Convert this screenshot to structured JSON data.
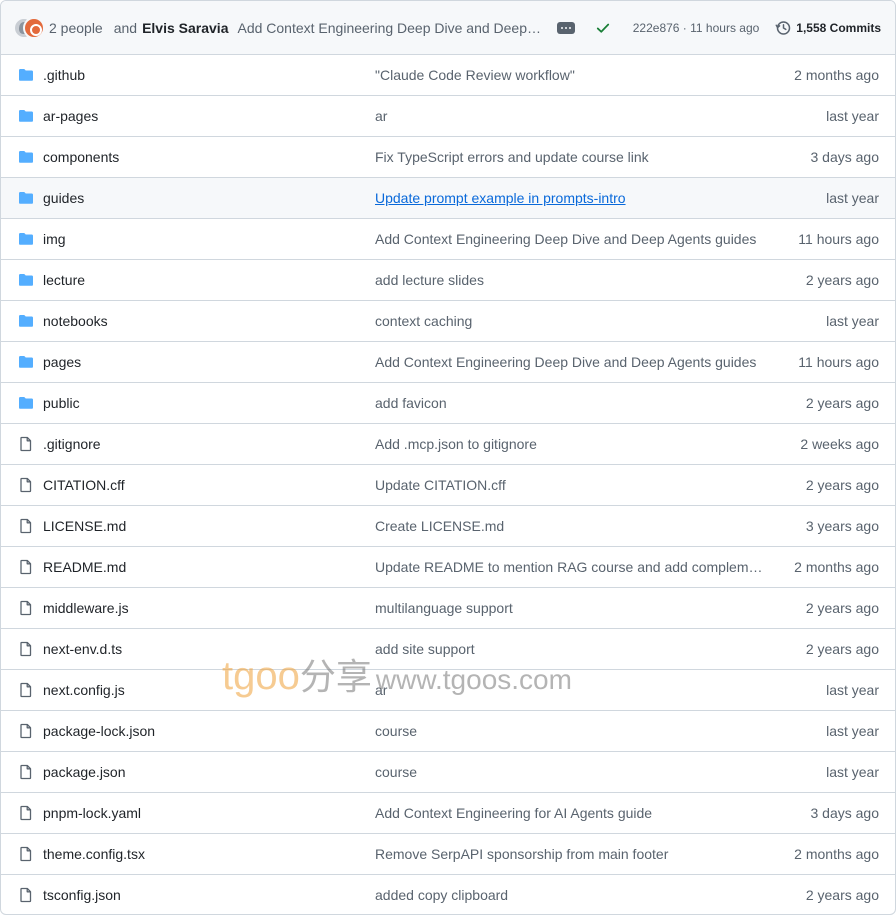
{
  "commit_bar": {
    "people": "2 people",
    "and_text": "and",
    "author": "Elvis Saravia",
    "message": "Add Context Engineering Deep Dive and Deep Agents guides",
    "hash_time": "222e876 · 11 hours ago",
    "commits": "1,558 Commits",
    "status_color": "#1a7f37"
  },
  "files": [
    {
      "type": "folder",
      "name": ".github",
      "message": "\"Claude Code Review workflow\"",
      "age": "2 months ago"
    },
    {
      "type": "folder",
      "name": "ar-pages",
      "message": "ar",
      "age": "last year"
    },
    {
      "type": "folder",
      "name": "components",
      "message": "Fix TypeScript errors and update course link",
      "age": "3 days ago"
    },
    {
      "type": "folder",
      "name": "guides",
      "message": "Update prompt example in prompts-intro",
      "age": "last year",
      "hovered": true
    },
    {
      "type": "folder",
      "name": "img",
      "message": "Add Context Engineering Deep Dive and Deep Agents guides",
      "age": "11 hours ago"
    },
    {
      "type": "folder",
      "name": "lecture",
      "message": "add lecture slides",
      "age": "2 years ago"
    },
    {
      "type": "folder",
      "name": "notebooks",
      "message": "context caching",
      "age": "last year"
    },
    {
      "type": "folder",
      "name": "pages",
      "message": "Add Context Engineering Deep Dive and Deep Agents guides",
      "age": "11 hours ago"
    },
    {
      "type": "folder",
      "name": "public",
      "message": "add favicon",
      "age": "2 years ago"
    },
    {
      "type": "file",
      "name": ".gitignore",
      "message": "Add .mcp.json to gitignore",
      "age": "2 weeks ago"
    },
    {
      "type": "file",
      "name": "CITATION.cff",
      "message": "Update CITATION.cff",
      "age": "2 years ago"
    },
    {
      "type": "file",
      "name": "LICENSE.md",
      "message": "Create LICENSE.md",
      "age": "3 years ago"
    },
    {
      "type": "file",
      "name": "README.md",
      "message": "Update README to mention RAG course and add complementary resources",
      "age": "2 months ago"
    },
    {
      "type": "file",
      "name": "middleware.js",
      "message": "multilanguage support",
      "age": "2 years ago"
    },
    {
      "type": "file",
      "name": "next-env.d.ts",
      "message": "add site support",
      "age": "2 years ago"
    },
    {
      "type": "file",
      "name": "next.config.js",
      "message": "ar",
      "age": "last year"
    },
    {
      "type": "file",
      "name": "package-lock.json",
      "message": "course",
      "age": "last year"
    },
    {
      "type": "file",
      "name": "package.json",
      "message": "course",
      "age": "last year"
    },
    {
      "type": "file",
      "name": "pnpm-lock.yaml",
      "message": "Add Context Engineering for AI Agents guide",
      "age": "3 days ago"
    },
    {
      "type": "file",
      "name": "theme.config.tsx",
      "message": "Remove SerpAPI sponsorship from main footer",
      "age": "2 months ago"
    },
    {
      "type": "file",
      "name": "tsconfig.json",
      "message": "added copy clipboard",
      "age": "2 years ago"
    }
  ],
  "icons": {
    "folder": "folder-icon",
    "file": "file-icon"
  },
  "colors": {
    "folder": "#54aeff",
    "link": "#0969da"
  },
  "watermark": {
    "brand": "tgoo",
    "cn": "分享",
    "url": "www.tgoos.com"
  }
}
